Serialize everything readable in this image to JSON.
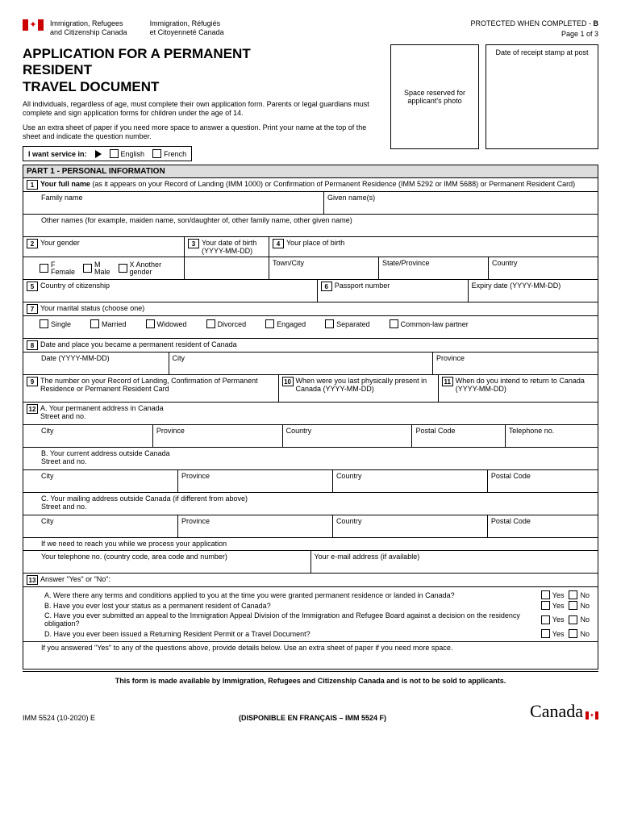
{
  "header": {
    "dept_en1": "Immigration, Refugees",
    "dept_en2": "and Citizenship Canada",
    "dept_fr1": "Immigration, Réfugiés",
    "dept_fr2": "et Citoyenneté Canada",
    "protected": "PROTECTED WHEN COMPLETED - ",
    "protected_b": "B",
    "page": "Page 1 of 3"
  },
  "title": {
    "line1": "APPLICATION FOR A PERMANENT",
    "line2": "RESIDENT",
    "line3": "TRAVEL DOCUMENT"
  },
  "instr1": "All individuals, regardless of age, must complete their own application form. Parents or legal guardians must complete and sign application forms for children under the age of 14.",
  "instr2": "Use an extra sheet of paper if you need more space to answer a question. Print your name at the top of the sheet and indicate the question number.",
  "photo_box": "Space reserved for applicant's photo",
  "stamp_box": "Date of receipt stamp at post",
  "service": {
    "label": "I want service in:",
    "english": "English",
    "french": "French"
  },
  "part1": "PART 1 - PERSONAL INFORMATION",
  "q1": {
    "num": "1",
    "text": "Your full name (as it appears on your Record of Landing (IMM 1000) or Confirmation of Permanent Residence (IMM 5292 or IMM 5688) or Permanent Resident Card)",
    "family": "Family name",
    "given": "Given name(s)",
    "other": "Other names (for example, maiden name, son/daughter of, other family name, other given name)"
  },
  "q2": {
    "num": "2",
    "text": "Your gender",
    "f": "F",
    "female": "Female",
    "m": "M",
    "male": "Male",
    "x": "X Another",
    "xg": "gender"
  },
  "q3": {
    "num": "3",
    "text": "Your date of birth",
    "fmt": "(YYYY-MM-DD)"
  },
  "q4": {
    "num": "4",
    "text": "Your place of birth",
    "town": "Town/City",
    "state": "State/Province",
    "country": "Country"
  },
  "q5": {
    "num": "5",
    "text": "Country of citizenship"
  },
  "q6": {
    "num": "6",
    "passport": "Passport number",
    "expiry": "Expiry date (YYYY-MM-DD)"
  },
  "q7": {
    "num": "7",
    "text": "Your marital status (choose one)",
    "single": "Single",
    "married": "Married",
    "widowed": "Widowed",
    "divorced": "Divorced",
    "engaged": "Engaged",
    "separated": "Separated",
    "commonlaw": "Common-law partner"
  },
  "q8": {
    "num": "8",
    "text": "Date and place you became a permanent resident of Canada",
    "date": "Date (YYYY-MM-DD)",
    "city": "City",
    "province": "Province"
  },
  "q9": {
    "num": "9",
    "text": "The number on your Record of Landing, Confirmation of Permanent Residence or Permanent Resident Card"
  },
  "q10": {
    "num": "10",
    "text": "When were you last physically present in Canada (YYYY-MM-DD)"
  },
  "q11": {
    "num": "11",
    "text": "When do you intend to return to Canada (YYYY-MM-DD)"
  },
  "q12": {
    "num": "12",
    "a": "A. Your permanent address in Canada",
    "b": "B. Your current address outside Canada",
    "c": "C. Your mailing address outside Canada (if different from above)",
    "street": "Street and no.",
    "city": "City",
    "province": "Province",
    "country": "Country",
    "postal": "Postal Code",
    "tel": "Telephone no.",
    "reach": "If we need to reach you while we process your application",
    "phone": "Your telephone no. (country code, area code and number)",
    "email": "Your e-mail address (if available)"
  },
  "q13": {
    "num": "13",
    "intro": "Answer \"Yes\" or \"No\":",
    "a": "A.  Were there any terms and conditions applied to you at the time you were granted permanent residence or landed in Canada?",
    "b": "B.  Have you ever lost your status as a permanent resident of Canada?",
    "c": "C.  Have you ever submitted an appeal to the Immigration Appeal Division of the Immigration and Refugee Board against a decision on the residency obligation?",
    "d": "D.  Have you ever been issued a Returning Resident Permit or a Travel Document?",
    "details": "If you answered \"Yes\" to any of the questions above, provide details below. Use an extra sheet of paper if you need more space.",
    "yes": "Yes",
    "no": "No"
  },
  "footer": {
    "note": "This form is made available by Immigration, Refugees and Citizenship Canada and is not to be sold to applicants.",
    "form_id": "IMM 5524 (10-2020) E",
    "french_avail": "(DISPONIBLE EN FRANÇAIS – IMM 5524 F)",
    "wordmark": "Canada"
  }
}
